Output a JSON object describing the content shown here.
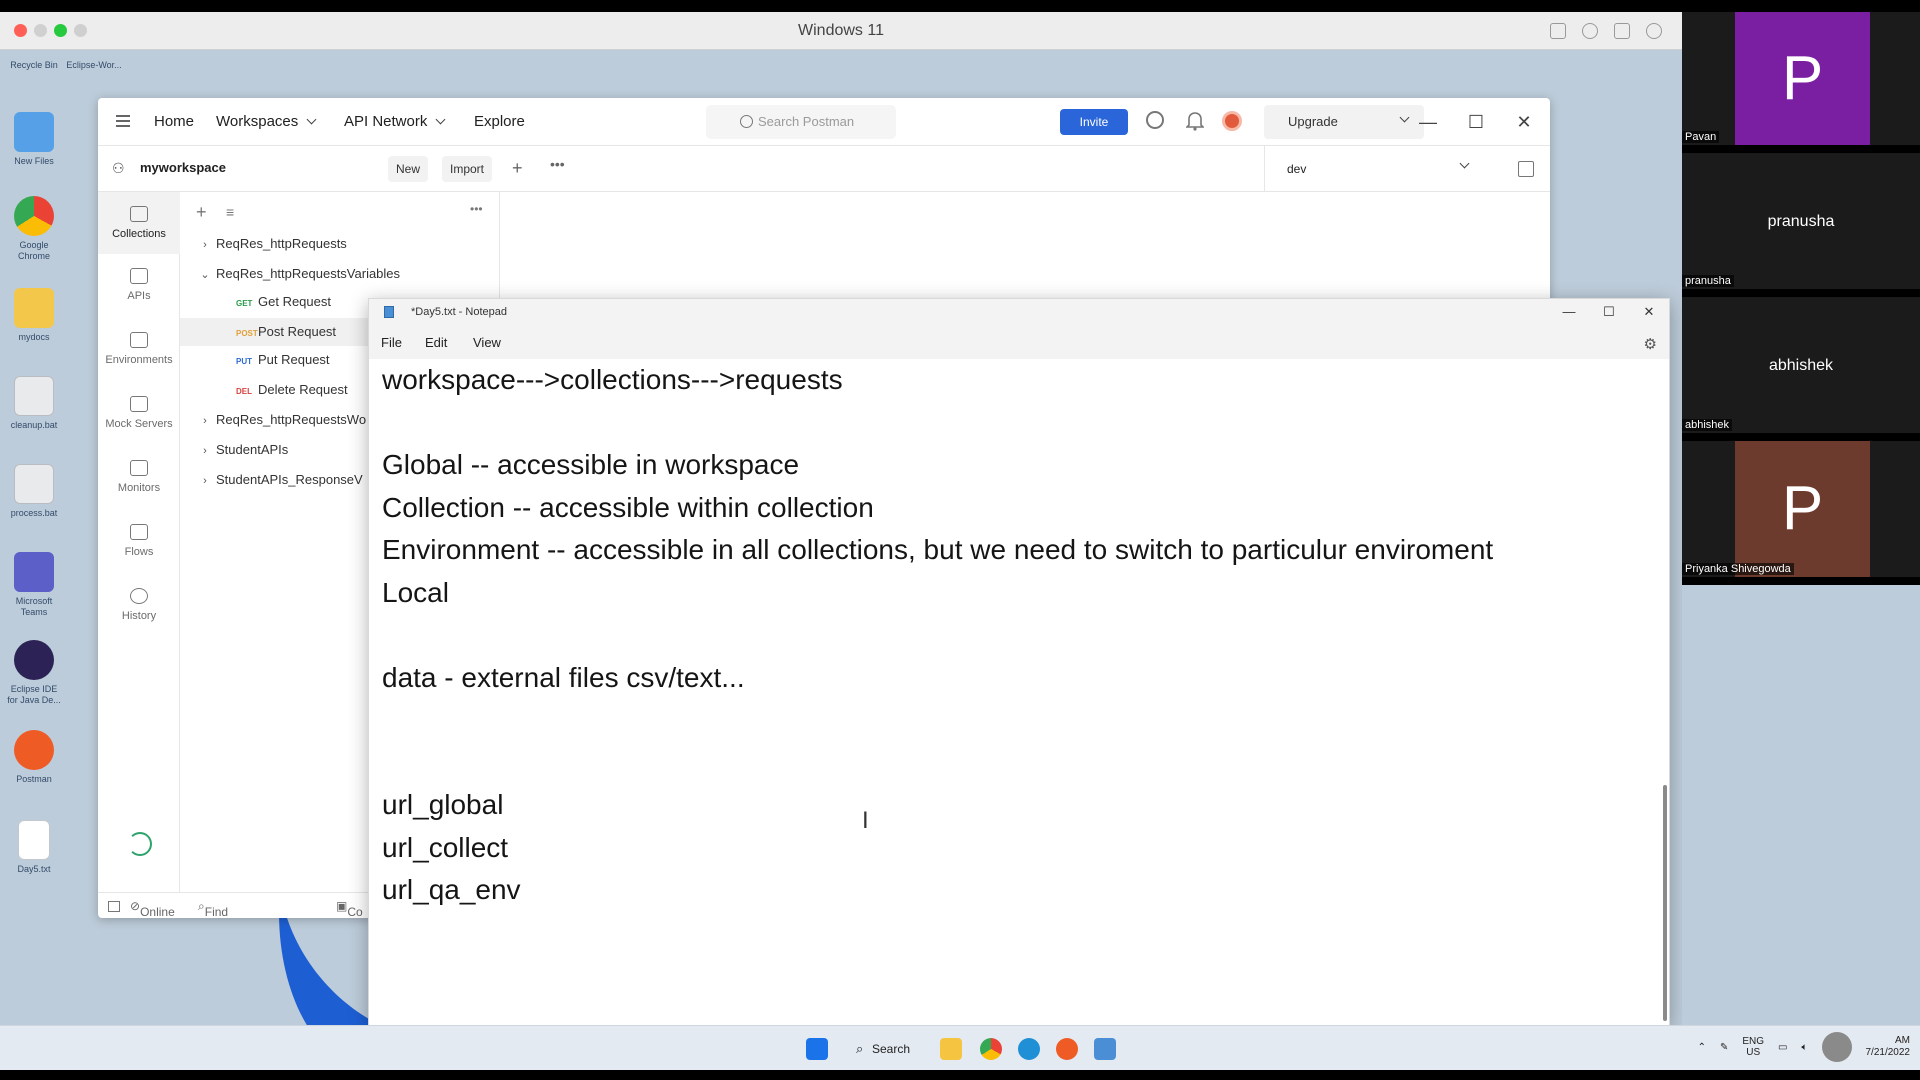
{
  "vm_window": {
    "title": "Windows 11",
    "traffic_colors": [
      "#ff5f56",
      "#ffbd2e",
      "#27c93f",
      "#cfcfcf"
    ]
  },
  "desktop_icons": [
    {
      "label": "Recycle Bin",
      "icon": "recycle-bin-icon",
      "color": "#dfe8f2"
    },
    {
      "label": "Eclipse-Wor...",
      "icon": "eclipse-workspace-icon",
      "color": "#e8eef5"
    },
    {
      "label": "New Files",
      "icon": "folder-icon",
      "color": "#55a0e6"
    },
    {
      "label": "Google Chrome",
      "icon": "chrome-icon",
      "color": "#ea4335"
    },
    {
      "label": "mydocs",
      "icon": "folder-icon",
      "color": "#f3c84a"
    },
    {
      "label": "cleanup.bat",
      "icon": "gears-file-icon",
      "color": "#e9eaec"
    },
    {
      "label": "process.bat",
      "icon": "gears-file-icon",
      "color": "#e9eaec"
    },
    {
      "label": "Microsoft Teams",
      "icon": "teams-icon",
      "color": "#5b5fc7"
    },
    {
      "label": "Eclipse IDE for Java De...",
      "icon": "eclipse-ide-icon",
      "color": "#2c2255"
    },
    {
      "label": "Postman",
      "icon": "postman-icon",
      "color": "#ef5b25"
    },
    {
      "label": "Day5.txt",
      "icon": "text-file-icon",
      "color": "#ffffff"
    }
  ],
  "postman": {
    "nav": {
      "home": "Home",
      "workspaces": "Workspaces",
      "api_network": "API Network",
      "explore": "Explore"
    },
    "search_placeholder": "Search Postman",
    "invite": "Invite",
    "upgrade": "Upgrade",
    "workspace_name": "myworkspace",
    "new_button": "New",
    "import_button": "Import",
    "environment": "dev",
    "rail": [
      {
        "label": "Collections",
        "icon": "collections-icon"
      },
      {
        "label": "APIs",
        "icon": "apis-icon"
      },
      {
        "label": "Environments",
        "icon": "environments-icon"
      },
      {
        "label": "Mock Servers",
        "icon": "mock-servers-icon"
      },
      {
        "label": "Monitors",
        "icon": "monitors-icon"
      },
      {
        "label": "Flows",
        "icon": "flows-icon"
      },
      {
        "label": "History",
        "icon": "history-icon"
      }
    ],
    "tree": {
      "c1": "ReqRes_httpRequests",
      "c2": "ReqRes_httpRequestsVariables",
      "r1_method": "GET",
      "r1": "Get Request",
      "r2_method": "POST",
      "r2": "Post Request",
      "r3_method": "PUT",
      "r3": "Put Request",
      "r4_method": "DEL",
      "r4": "Delete Request",
      "c3": "ReqRes_httpRequestsWo",
      "c4": "StudentAPIs",
      "c5": "StudentAPIs_ResponseV"
    },
    "status": {
      "online": "Online",
      "find_replace": "Find and Replace",
      "console": "Co"
    }
  },
  "notepad": {
    "title": "*Day5.txt - Notepad",
    "menu": {
      "file": "File",
      "edit": "Edit",
      "view": "View"
    },
    "lines": {
      "l1": "workspace--->collections--->requests",
      "l2": "",
      "l3": "Global -- accessible in workspace",
      "l4": "Collection -- accessible within collection",
      "l5": "Environment -- accessible in all collections, but we need to switch to particulur enviroment",
      "l6": "Local",
      "l7": "",
      "l8": "data - external files csv/text...",
      "l9": "",
      "l10": "",
      "l11": "url_global",
      "l12": "url_collect",
      "l13": "url_qa_env"
    }
  },
  "taskbar": {
    "search": "Search",
    "lang_top": "ENG",
    "lang_bottom": "US",
    "time": "AM",
    "date": "7/21/2022"
  },
  "participants": {
    "p1_initial": "P",
    "p1_name": "Pavan",
    "p1_color": "#7b1fa2",
    "p2_name": "pranusha",
    "p3_name": "abhishek",
    "p4_initial": "P",
    "p4_name": "Priyanka Shivegowda",
    "p4_color": "#6d3a2e"
  }
}
